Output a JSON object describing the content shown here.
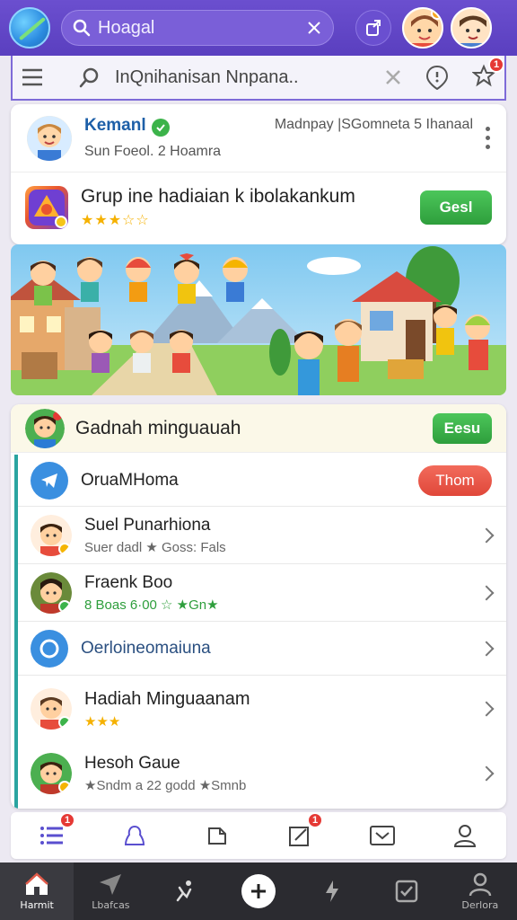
{
  "topbar": {
    "search_text": "Hoagal",
    "avatar_badge_color": "#f5a623"
  },
  "subbar": {
    "search_text": "InQnihanisan Nnpana..",
    "notif_count": "1"
  },
  "user_card": {
    "name": "Kemanl",
    "subtitle": "Sun Foeol. 2 Hoamra",
    "meta": "Madnpay |SGomneta 5 Ihanaal"
  },
  "group_row": {
    "title": "Grup ine hadiaian k ibolakankum",
    "stars": "★★★☆☆",
    "button_label": "Gesl"
  },
  "section": {
    "title": "Gadnah minguauah",
    "button_label": "Eesu"
  },
  "list_items": [
    {
      "title": "OruaMHoma",
      "button_label": "Thom"
    },
    {
      "title": "Suel Punarhiona",
      "subtitle": "Suer dadl ★ Goss: Fals"
    },
    {
      "title": "Fraenk Boo",
      "subtitle": "8 Boas 6·00 ☆ ★Gn★"
    },
    {
      "title": "Oerloineomaiuna"
    },
    {
      "title": "Hadiah Minguaanam",
      "subtitle": "★★★"
    },
    {
      "title": "Hesoh Gaue",
      "subtitle": "★Sndm a 22 godd ★Smnb"
    }
  ],
  "nav1": {
    "badge_left": "1",
    "badge_mid": "1"
  },
  "nav2": {
    "items": [
      "Harmit",
      "Lbafcas",
      "",
      "",
      "",
      "",
      "Derlora"
    ]
  },
  "colors": {
    "primary": "#5a3fbf",
    "green": "#3cb34a",
    "red": "#e0473a",
    "teal": "#2aa4a0"
  }
}
